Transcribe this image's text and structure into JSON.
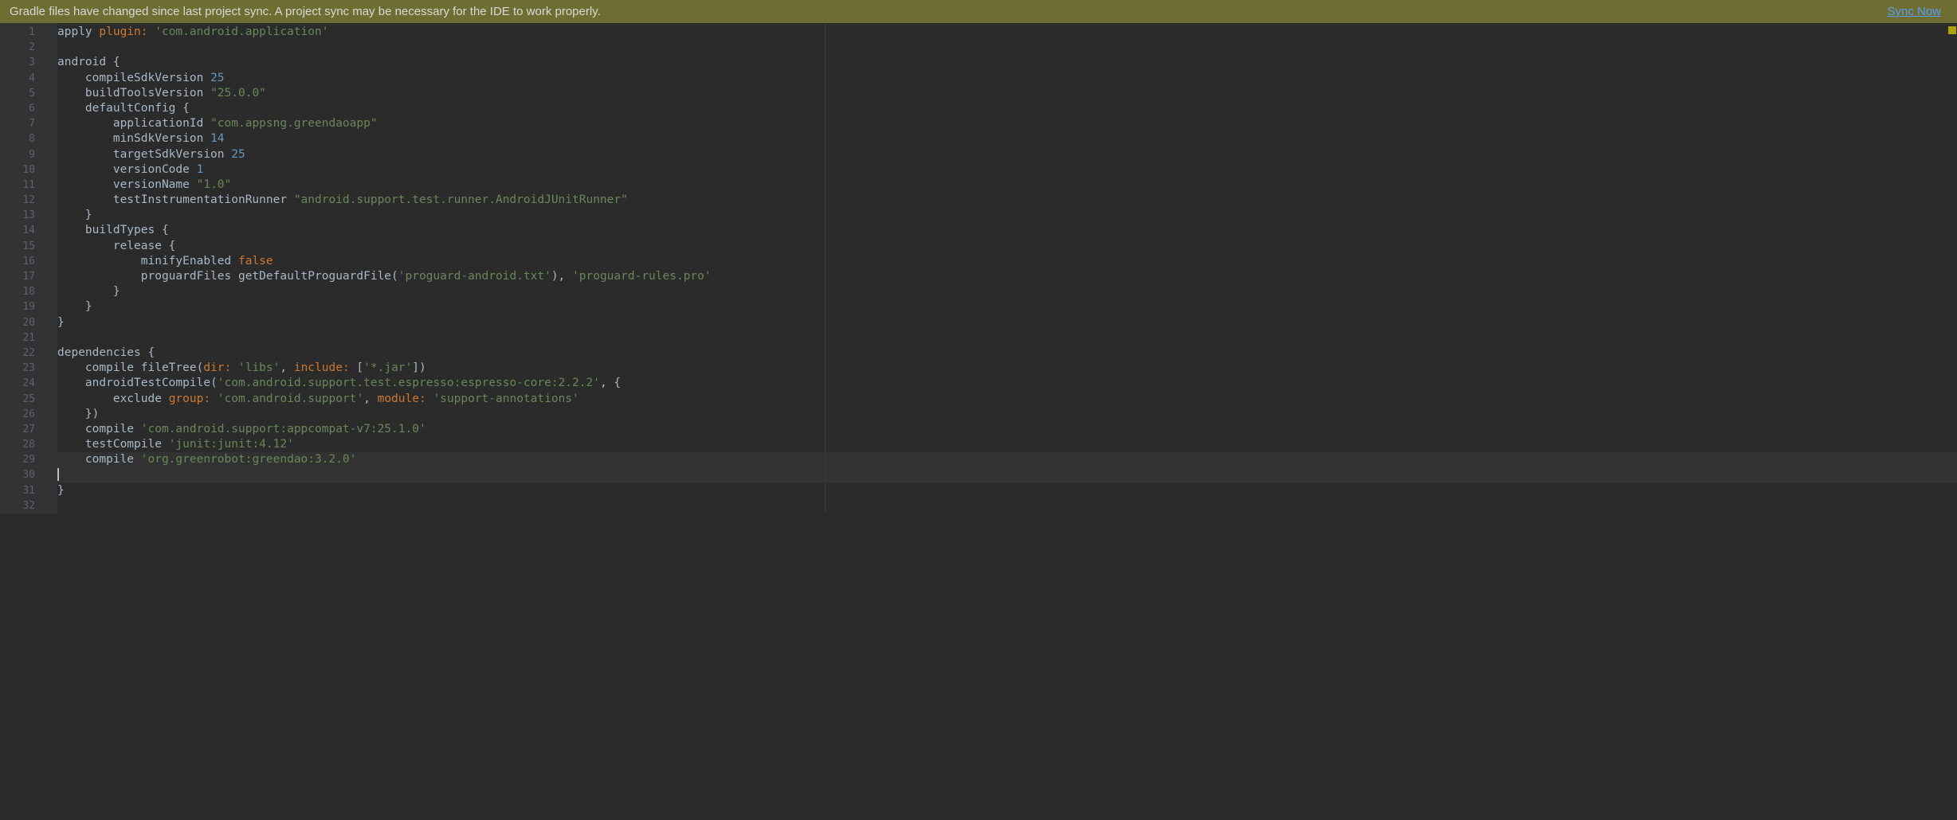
{
  "notification": {
    "message": "Gradle files have changed since last project sync. A project sync may be necessary for the IDE to work properly.",
    "action": "Sync Now"
  },
  "gutter": {
    "lines": [
      "1",
      "2",
      "3",
      "4",
      "5",
      "6",
      "7",
      "8",
      "9",
      "10",
      "11",
      "12",
      "13",
      "14",
      "15",
      "16",
      "17",
      "18",
      "19",
      "20",
      "21",
      "22",
      "23",
      "24",
      "25",
      "26",
      "27",
      "28",
      "29",
      "30",
      "31",
      "32"
    ]
  },
  "code": {
    "l1": {
      "a": "apply ",
      "b": "plugin: ",
      "c": "'com.android.application'"
    },
    "l3": {
      "a": "android {"
    },
    "l4": {
      "a": "    compileSdkVersion ",
      "b": "25"
    },
    "l5": {
      "a": "    buildToolsVersion ",
      "b": "\"25.0.0\""
    },
    "l6": {
      "a": "    defaultConfig {"
    },
    "l7": {
      "a": "        applicationId ",
      "b": "\"com.appsng.greendaoapp\""
    },
    "l8": {
      "a": "        minSdkVersion ",
      "b": "14"
    },
    "l9": {
      "a": "        targetSdkVersion ",
      "b": "25"
    },
    "l10": {
      "a": "        versionCode ",
      "b": "1"
    },
    "l11": {
      "a": "        versionName ",
      "b": "\"1.0\""
    },
    "l12": {
      "a": "        testInstrumentationRunner ",
      "b": "\"android.support.test.runner.AndroidJUnitRunner\""
    },
    "l13": {
      "a": "    }"
    },
    "l14": {
      "a": "    buildTypes {"
    },
    "l15": {
      "a": "        release {"
    },
    "l16": {
      "a": "            minifyEnabled ",
      "b": "false"
    },
    "l17": {
      "a": "            proguardFiles getDefaultProguardFile(",
      "b": "'proguard-android.txt'",
      "c": "), ",
      "d": "'proguard-rules.pro'"
    },
    "l18": {
      "a": "        }"
    },
    "l19": {
      "a": "    }"
    },
    "l20": {
      "a": "}"
    },
    "l22": {
      "a": "dependencies {"
    },
    "l23": {
      "a": "    compile fileTree(",
      "b": "dir: ",
      "c": "'libs'",
      "d": ", ",
      "e": "include: ",
      "f": "[",
      "g": "'*.jar'",
      "h": "])"
    },
    "l24": {
      "a": "    androidTestCompile(",
      "b": "'com.android.support.test.espresso:espresso-core:2.2.2'",
      "c": ", {"
    },
    "l25": {
      "a": "        exclude ",
      "b": "group: ",
      "c": "'com.android.support'",
      "d": ", ",
      "e": "module: ",
      "f": "'support-annotations'"
    },
    "l26": {
      "a": "    })"
    },
    "l27": {
      "a": "    compile ",
      "b": "'com.android.support:appcompat-v7:25.1.0'"
    },
    "l28": {
      "a": "    testCompile ",
      "b": "'junit:junit:4.12'"
    },
    "l29": {
      "a": "    compile ",
      "b": "'org.greenrobot:greendao:3.2.0'"
    },
    "l31": {
      "a": "}"
    }
  }
}
